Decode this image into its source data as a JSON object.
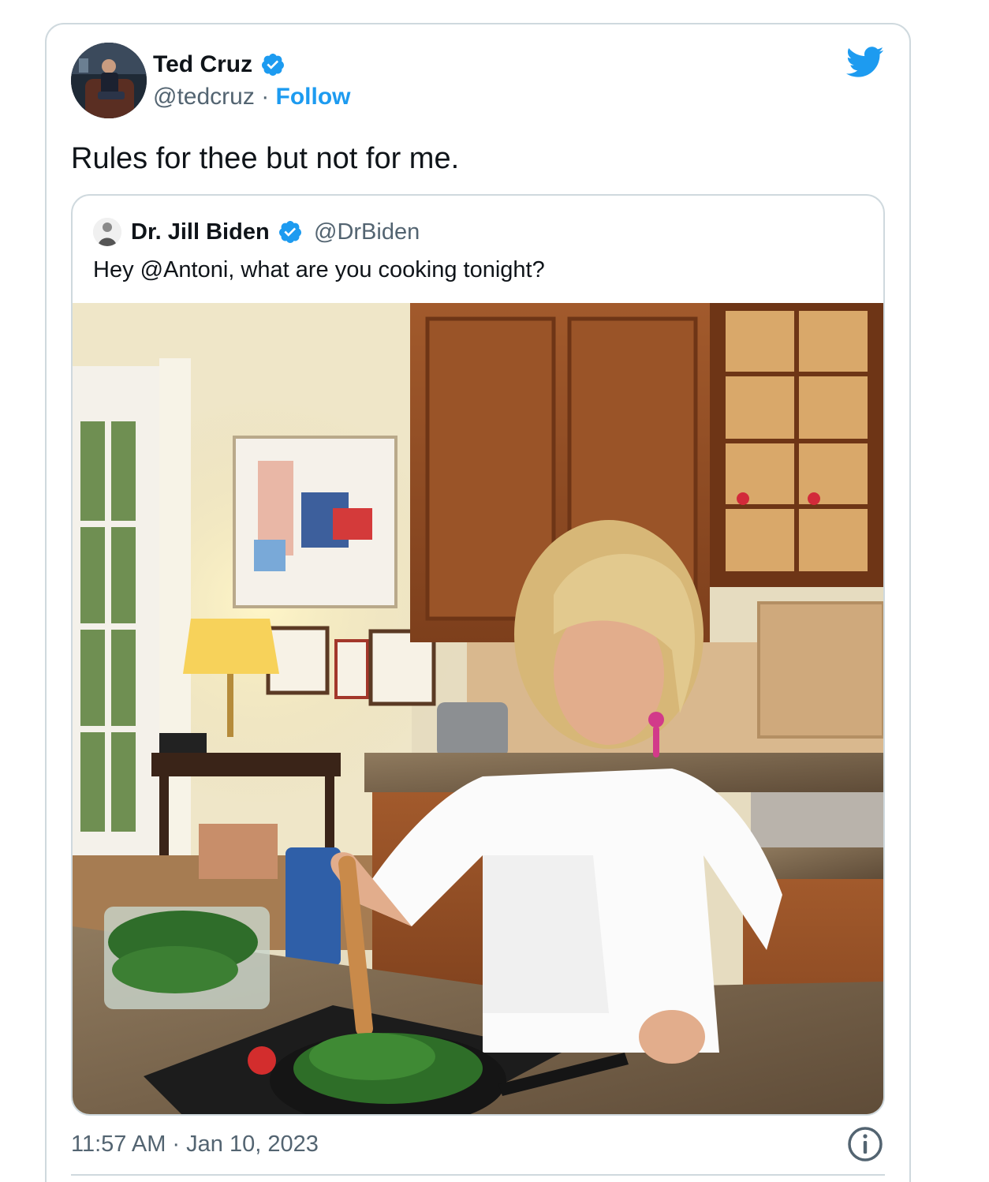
{
  "author": {
    "name": "Ted Cruz",
    "handle": "@tedcruz",
    "separator": "·",
    "follow_label": "Follow"
  },
  "tweet": {
    "text": "Rules for thee but not for me.",
    "timestamp": "11:57 AM · Jan 10, 2023"
  },
  "quoted": {
    "name": "Dr. Jill Biden",
    "handle": "@DrBiden",
    "text": "Hey @Antoni, what are you cooking tonight?"
  },
  "icons": {
    "verified": "verified-badge-icon",
    "platform": "twitter-bird-icon",
    "info": "info-icon"
  },
  "colors": {
    "accent": "#1d9bf0",
    "text": "#0f1419",
    "muted": "#536471",
    "border": "#cfd9de"
  }
}
